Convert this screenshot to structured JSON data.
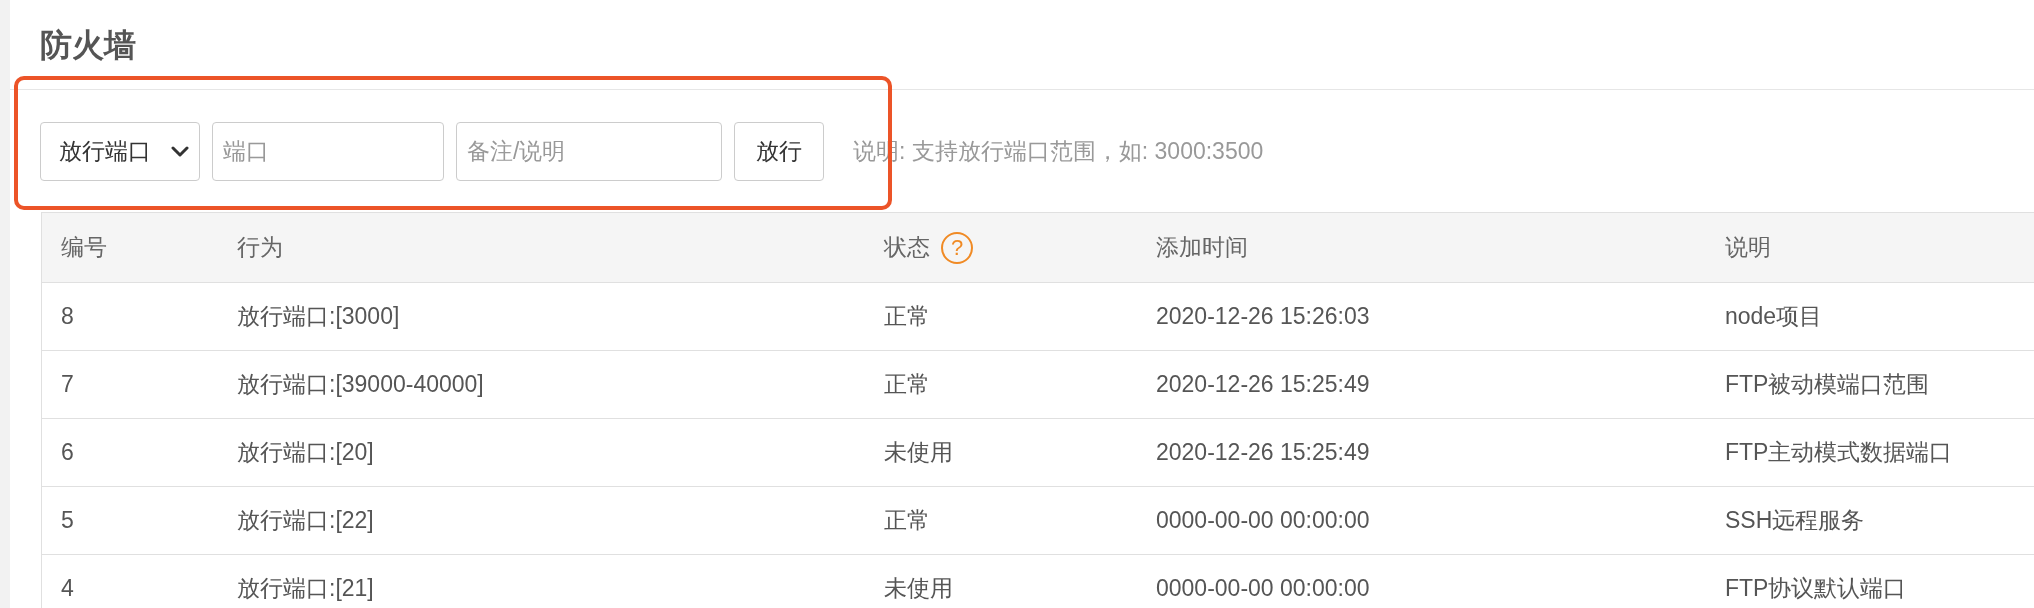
{
  "page": {
    "title": "防火墙"
  },
  "toolbar": {
    "action_select": {
      "value": "放行端口"
    },
    "port_field": {
      "placeholder": "端口"
    },
    "note_field": {
      "placeholder": "备注/说明"
    },
    "submit_button": "放行",
    "hint": "说明: 支持放行端口范围，如: 3000:3500"
  },
  "table": {
    "columns": [
      {
        "label": "编号"
      },
      {
        "label": "行为"
      },
      {
        "label": "状态",
        "help_icon": "?"
      },
      {
        "label": "添加时间"
      },
      {
        "label": "说明"
      }
    ],
    "rows": [
      {
        "id": "8",
        "action": "放行端口:[3000]",
        "status": "正常",
        "added": "2020-12-26 15:26:03",
        "note": "node项目"
      },
      {
        "id": "7",
        "action": "放行端口:[39000-40000]",
        "status": "正常",
        "added": "2020-12-26 15:25:49",
        "note": "FTP被动模端口范围"
      },
      {
        "id": "6",
        "action": "放行端口:[20]",
        "status": "未使用",
        "added": "2020-12-26 15:25:49",
        "note": "FTP主动模式数据端口"
      },
      {
        "id": "5",
        "action": "放行端口:[22]",
        "status": "正常",
        "added": "0000-00-00 00:00:00",
        "note": "SSH远程服务"
      },
      {
        "id": "4",
        "action": "放行端口:[21]",
        "status": "未使用",
        "added": "0000-00-00 00:00:00",
        "note": "FTP协议默认端口"
      }
    ]
  }
}
